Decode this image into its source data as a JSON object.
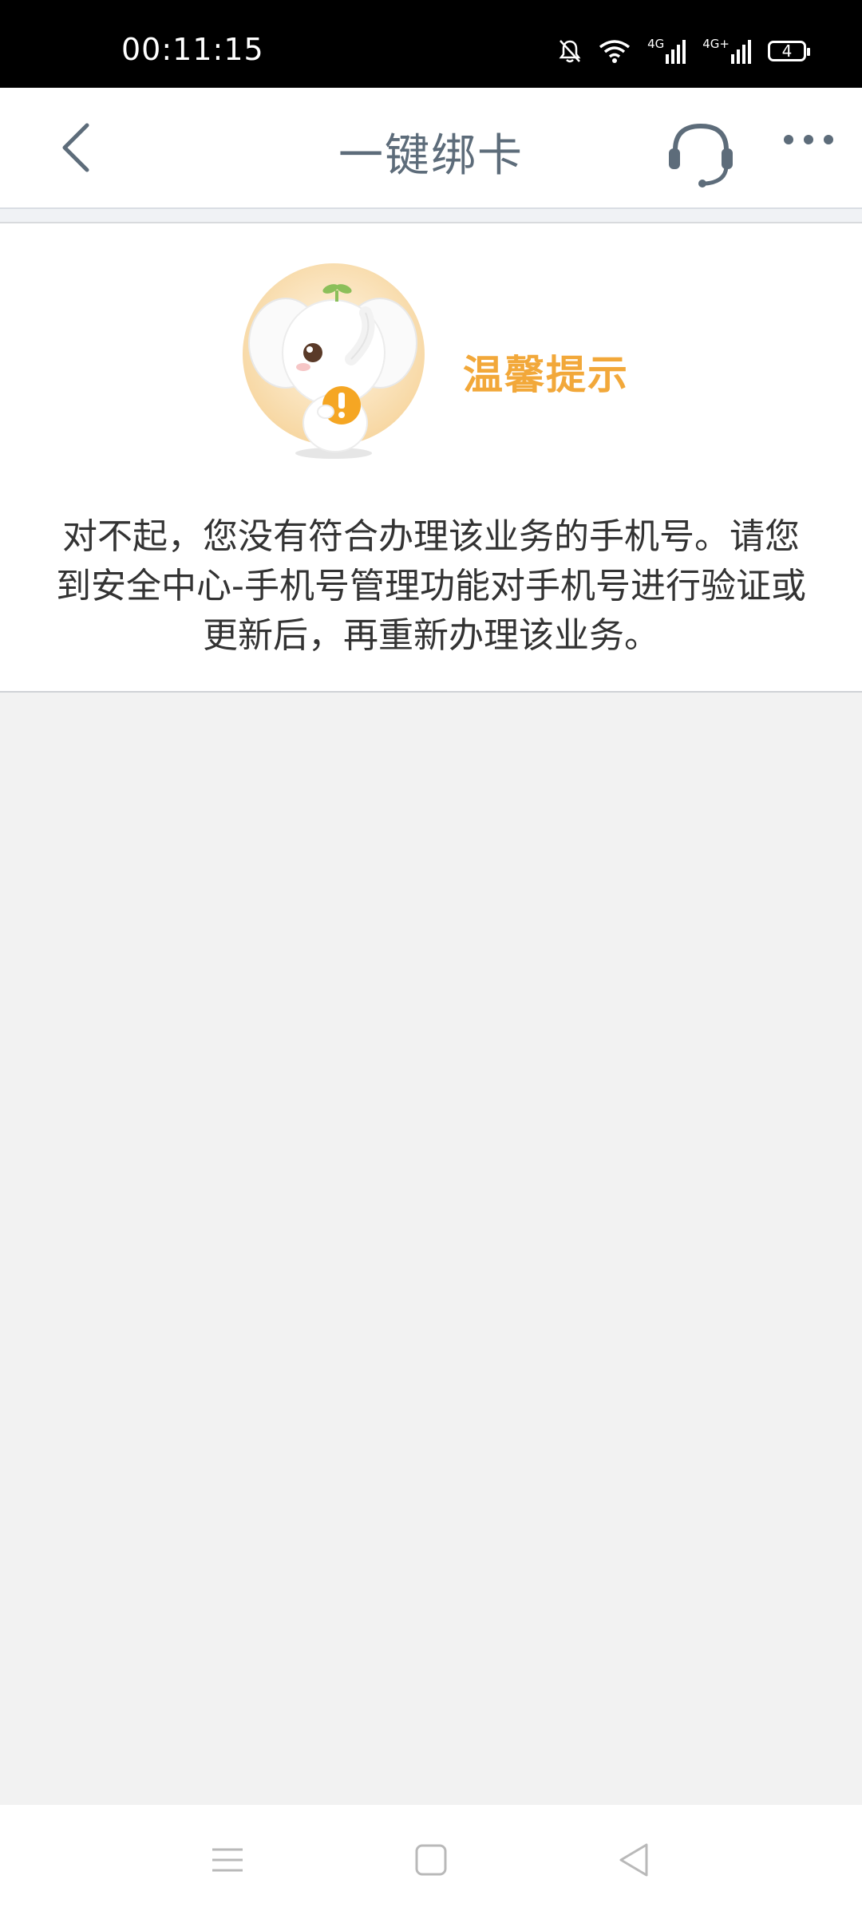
{
  "status_bar": {
    "time": "00:11:15",
    "battery_level": "4",
    "network_1": "4G",
    "network_2": "4G+",
    "icons": [
      "bell-muted-icon",
      "wifi-icon",
      "signal-4g-icon",
      "signal-4g-plus-icon",
      "battery-icon"
    ]
  },
  "header": {
    "title": "一键绑卡",
    "back_icon": "chevron-left-icon",
    "support_icon": "headset-icon",
    "more_icon": "more-horizontal-icon"
  },
  "notice": {
    "title": "温馨提示",
    "message": "对不起，您没有符合办理该业务的手机号。请您到安全中心-手机号管理功能对手机号进行验证或更新后，再重新办理该业务。",
    "mascot_icon": "elephant-mascot-warning-icon",
    "accent_color": "#f2a83a"
  },
  "system_nav": {
    "menu_icon": "menu-lines-icon",
    "home_icon": "home-square-icon",
    "back_icon": "back-triangle-icon"
  },
  "colors": {
    "status_bar_bg": "#000000",
    "header_text": "#5d6c7a",
    "page_bg": "#f2f2f2"
  }
}
